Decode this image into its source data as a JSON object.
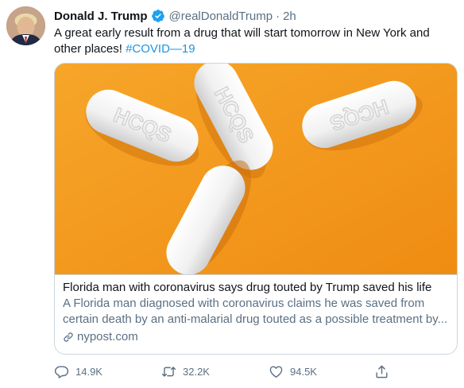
{
  "tweet": {
    "author_name": "Donald J. Trump",
    "handle": "@realDonaldTrump",
    "separator": "·",
    "time": "2h",
    "text": "A great early result from a drug that will start tomorrow in New York and other places!",
    "hashtag": "#COVID—19"
  },
  "card": {
    "title": "Florida man with coronavirus says drug touted by Trump saved his life",
    "description": "A Florida man diagnosed with coronavirus claims he was saved from certain death by an anti-malarial drug touted as a possible treatment by...",
    "domain": "nypost.com",
    "pill_imprint": "HCQS"
  },
  "actions": {
    "replies": "14.9K",
    "retweets": "32.2K",
    "likes": "94.5K"
  },
  "icons": {
    "verified": "verified-badge-icon",
    "link": "link-icon",
    "reply": "reply-icon",
    "retweet": "retweet-icon",
    "like": "heart-icon",
    "share": "share-icon"
  },
  "colors": {
    "link_blue": "#1b95e0",
    "verified_blue": "#1da1f2",
    "muted_text": "#5b7083",
    "card_background": "#f39a1c",
    "border": "#ccd6dd"
  }
}
